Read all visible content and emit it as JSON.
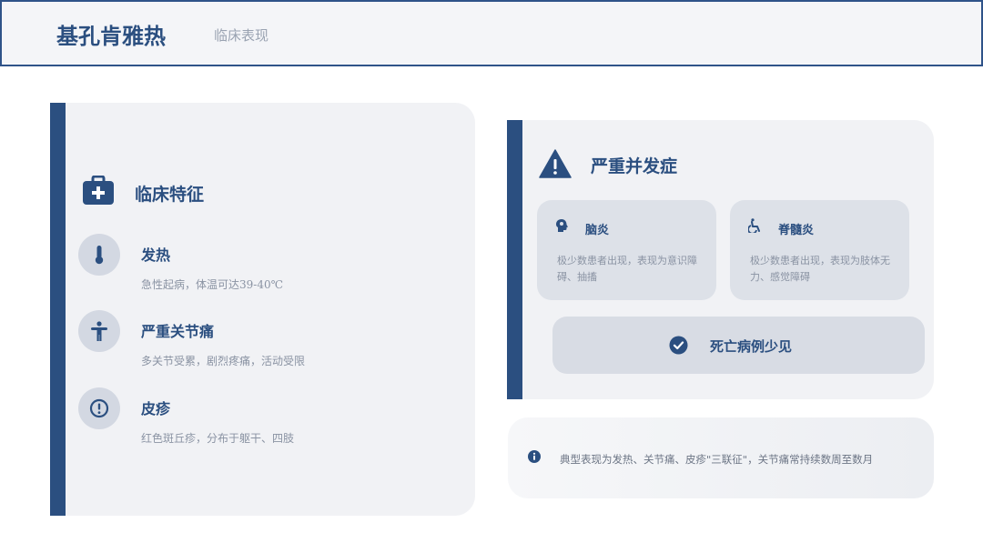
{
  "header": {
    "title": "基孔肯雅热",
    "subtitle": "临床表现"
  },
  "clinical": {
    "title": "临床特征",
    "features": [
      {
        "name": "发热",
        "desc": "急性起病，体温可达39-40℃",
        "icon": "thermometer-icon"
      },
      {
        "name": "严重关节痛",
        "desc": "多关节受累，剧烈疼痛，活动受限",
        "icon": "person-icon"
      },
      {
        "name": "皮疹",
        "desc": "红色斑丘疹，分布于躯干、四肢",
        "icon": "alert-circle-icon"
      }
    ]
  },
  "complications": {
    "title": "严重并发症",
    "items": [
      {
        "name": "脑炎",
        "desc": "极少数患者出现，表现为意识障碍、抽搐",
        "icon": "brain-icon"
      },
      {
        "name": "脊髓炎",
        "desc": "极少数患者出现，表现为肢体无力、感觉障碍",
        "icon": "wheelchair-icon"
      }
    ],
    "death_note": "死亡病例少见"
  },
  "note": {
    "text": "典型表现为发热、关节痛、皮疹\"三联征\"，关节痛常持续数周至数月"
  },
  "colors": {
    "primary": "#2b4f80",
    "card_bg": "#f1f2f5",
    "muted_text": "#8a93a3"
  }
}
